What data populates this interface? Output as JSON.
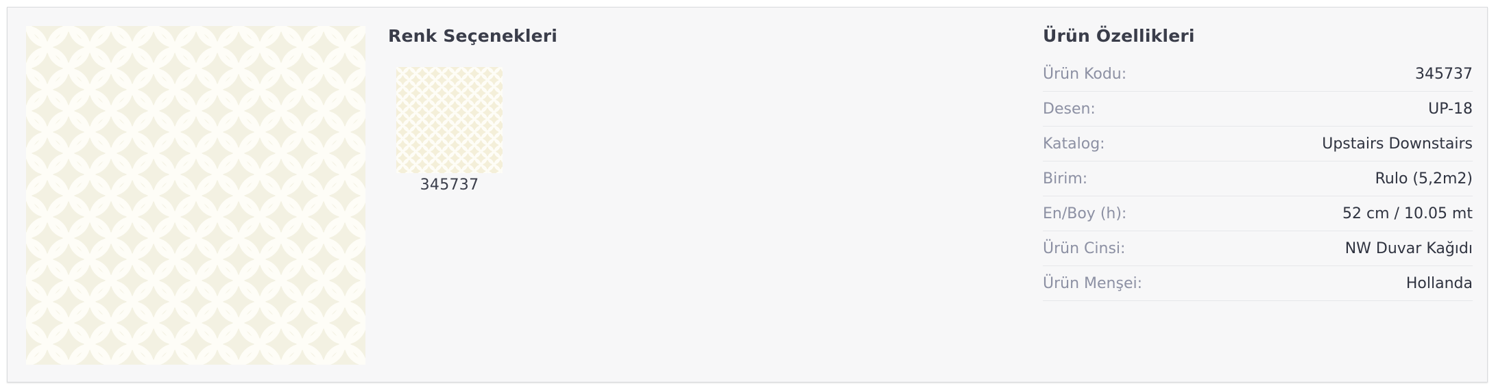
{
  "colors": {
    "card_bg": "#f7f7f8",
    "pattern_bg": "#f3f1e2",
    "pattern_line": "#fefdf7",
    "label": "#8c90a3",
    "value": "#2f3340"
  },
  "product": {
    "image_icon": "wallpaper-pattern-image"
  },
  "variants": {
    "title": "Renk Seçenekleri",
    "items": [
      {
        "code": "345737"
      }
    ]
  },
  "properties": {
    "title": "Ürün Özellikleri",
    "rows": [
      {
        "label": "Ürün Kodu:",
        "value": "345737"
      },
      {
        "label": "Desen:",
        "value": "UP-18"
      },
      {
        "label": "Katalog:",
        "value": "Upstairs Downstairs"
      },
      {
        "label": "Birim:",
        "value": "Rulo (5,2m2)"
      },
      {
        "label": "En/Boy (h):",
        "value": "52 cm / 10.05 mt"
      },
      {
        "label": "Ürün Cinsi:",
        "value": "NW Duvar Kağıdı"
      },
      {
        "label": "Ürün Menşei:",
        "value": "Hollanda"
      }
    ]
  }
}
